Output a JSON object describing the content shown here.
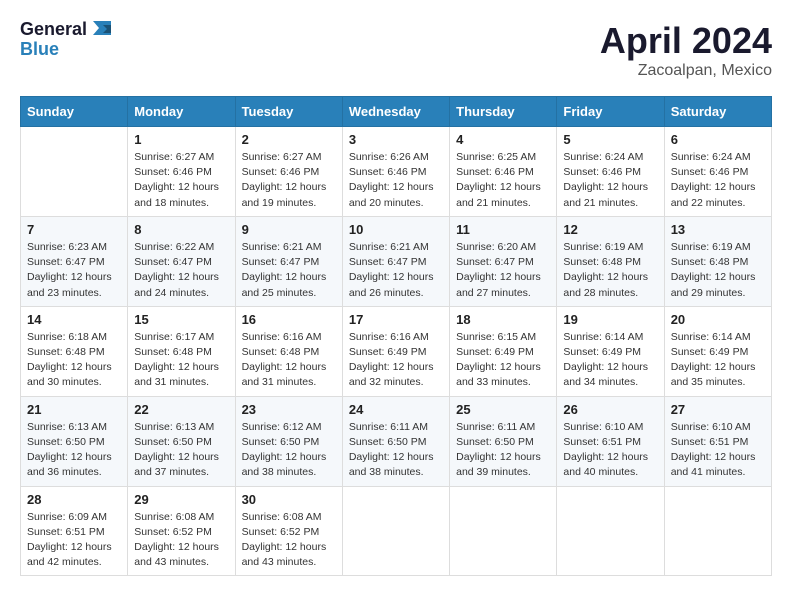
{
  "header": {
    "logo_line1": "General",
    "logo_line2": "Blue",
    "title": "April 2024",
    "subtitle": "Zacoalpan, Mexico"
  },
  "calendar": {
    "days_of_week": [
      "Sunday",
      "Monday",
      "Tuesday",
      "Wednesday",
      "Thursday",
      "Friday",
      "Saturday"
    ],
    "weeks": [
      [
        {
          "day": "",
          "info": ""
        },
        {
          "day": "1",
          "info": "Sunrise: 6:27 AM\nSunset: 6:46 PM\nDaylight: 12 hours\nand 18 minutes."
        },
        {
          "day": "2",
          "info": "Sunrise: 6:27 AM\nSunset: 6:46 PM\nDaylight: 12 hours\nand 19 minutes."
        },
        {
          "day": "3",
          "info": "Sunrise: 6:26 AM\nSunset: 6:46 PM\nDaylight: 12 hours\nand 20 minutes."
        },
        {
          "day": "4",
          "info": "Sunrise: 6:25 AM\nSunset: 6:46 PM\nDaylight: 12 hours\nand 21 minutes."
        },
        {
          "day": "5",
          "info": "Sunrise: 6:24 AM\nSunset: 6:46 PM\nDaylight: 12 hours\nand 21 minutes."
        },
        {
          "day": "6",
          "info": "Sunrise: 6:24 AM\nSunset: 6:46 PM\nDaylight: 12 hours\nand 22 minutes."
        }
      ],
      [
        {
          "day": "7",
          "info": "Sunrise: 6:23 AM\nSunset: 6:47 PM\nDaylight: 12 hours\nand 23 minutes."
        },
        {
          "day": "8",
          "info": "Sunrise: 6:22 AM\nSunset: 6:47 PM\nDaylight: 12 hours\nand 24 minutes."
        },
        {
          "day": "9",
          "info": "Sunrise: 6:21 AM\nSunset: 6:47 PM\nDaylight: 12 hours\nand 25 minutes."
        },
        {
          "day": "10",
          "info": "Sunrise: 6:21 AM\nSunset: 6:47 PM\nDaylight: 12 hours\nand 26 minutes."
        },
        {
          "day": "11",
          "info": "Sunrise: 6:20 AM\nSunset: 6:47 PM\nDaylight: 12 hours\nand 27 minutes."
        },
        {
          "day": "12",
          "info": "Sunrise: 6:19 AM\nSunset: 6:48 PM\nDaylight: 12 hours\nand 28 minutes."
        },
        {
          "day": "13",
          "info": "Sunrise: 6:19 AM\nSunset: 6:48 PM\nDaylight: 12 hours\nand 29 minutes."
        }
      ],
      [
        {
          "day": "14",
          "info": "Sunrise: 6:18 AM\nSunset: 6:48 PM\nDaylight: 12 hours\nand 30 minutes."
        },
        {
          "day": "15",
          "info": "Sunrise: 6:17 AM\nSunset: 6:48 PM\nDaylight: 12 hours\nand 31 minutes."
        },
        {
          "day": "16",
          "info": "Sunrise: 6:16 AM\nSunset: 6:48 PM\nDaylight: 12 hours\nand 31 minutes."
        },
        {
          "day": "17",
          "info": "Sunrise: 6:16 AM\nSunset: 6:49 PM\nDaylight: 12 hours\nand 32 minutes."
        },
        {
          "day": "18",
          "info": "Sunrise: 6:15 AM\nSunset: 6:49 PM\nDaylight: 12 hours\nand 33 minutes."
        },
        {
          "day": "19",
          "info": "Sunrise: 6:14 AM\nSunset: 6:49 PM\nDaylight: 12 hours\nand 34 minutes."
        },
        {
          "day": "20",
          "info": "Sunrise: 6:14 AM\nSunset: 6:49 PM\nDaylight: 12 hours\nand 35 minutes."
        }
      ],
      [
        {
          "day": "21",
          "info": "Sunrise: 6:13 AM\nSunset: 6:50 PM\nDaylight: 12 hours\nand 36 minutes."
        },
        {
          "day": "22",
          "info": "Sunrise: 6:13 AM\nSunset: 6:50 PM\nDaylight: 12 hours\nand 37 minutes."
        },
        {
          "day": "23",
          "info": "Sunrise: 6:12 AM\nSunset: 6:50 PM\nDaylight: 12 hours\nand 38 minutes."
        },
        {
          "day": "24",
          "info": "Sunrise: 6:11 AM\nSunset: 6:50 PM\nDaylight: 12 hours\nand 38 minutes."
        },
        {
          "day": "25",
          "info": "Sunrise: 6:11 AM\nSunset: 6:50 PM\nDaylight: 12 hours\nand 39 minutes."
        },
        {
          "day": "26",
          "info": "Sunrise: 6:10 AM\nSunset: 6:51 PM\nDaylight: 12 hours\nand 40 minutes."
        },
        {
          "day": "27",
          "info": "Sunrise: 6:10 AM\nSunset: 6:51 PM\nDaylight: 12 hours\nand 41 minutes."
        }
      ],
      [
        {
          "day": "28",
          "info": "Sunrise: 6:09 AM\nSunset: 6:51 PM\nDaylight: 12 hours\nand 42 minutes."
        },
        {
          "day": "29",
          "info": "Sunrise: 6:08 AM\nSunset: 6:52 PM\nDaylight: 12 hours\nand 43 minutes."
        },
        {
          "day": "30",
          "info": "Sunrise: 6:08 AM\nSunset: 6:52 PM\nDaylight: 12 hours\nand 43 minutes."
        },
        {
          "day": "",
          "info": ""
        },
        {
          "day": "",
          "info": ""
        },
        {
          "day": "",
          "info": ""
        },
        {
          "day": "",
          "info": ""
        }
      ]
    ]
  }
}
